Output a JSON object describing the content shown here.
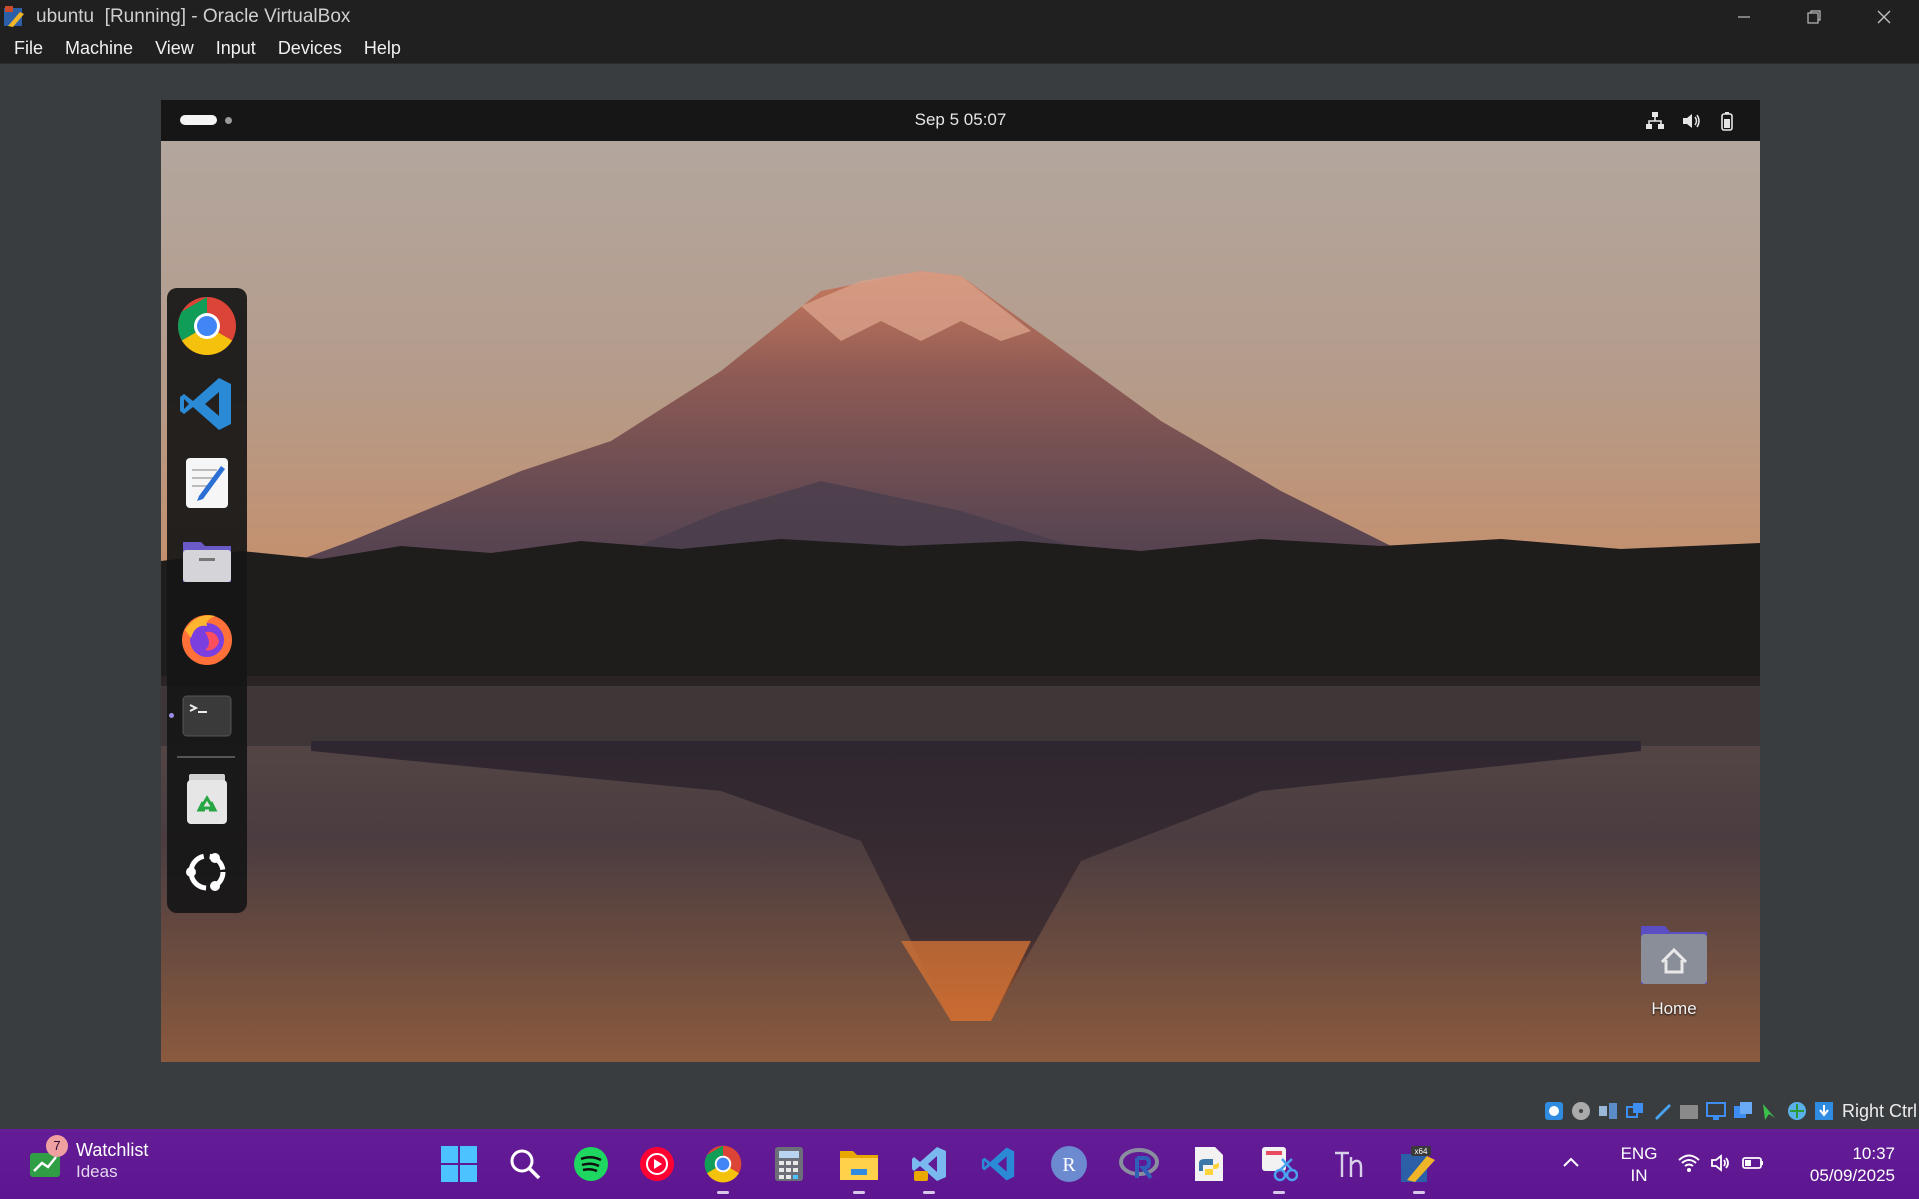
{
  "window": {
    "title": "ubuntu  [Running] - Oracle VirtualBox",
    "controls": [
      "minimize-icon",
      "restore-icon",
      "close-icon"
    ]
  },
  "menu": [
    "File",
    "Machine",
    "View",
    "Input",
    "Devices",
    "Help"
  ],
  "guest": {
    "topbar": {
      "clock": "Sep 5  05:07",
      "system_icons": [
        "network-icon",
        "volume-icon",
        "battery-icon"
      ]
    },
    "dock": [
      {
        "name": "Google Chrome",
        "icon": "chrome-icon"
      },
      {
        "name": "Visual Studio Code",
        "icon": "vscode-icon"
      },
      {
        "name": "Text Editor",
        "icon": "text-editor-icon"
      },
      {
        "name": "Files",
        "icon": "files-icon"
      },
      {
        "name": "Firefox",
        "icon": "firefox-icon"
      },
      {
        "name": "Terminal",
        "icon": "terminal-icon",
        "running": true
      },
      {
        "name": "Trash",
        "icon": "trash-icon"
      },
      {
        "name": "Show Apps",
        "icon": "ubuntu-apps-icon"
      }
    ],
    "desktop": {
      "home_label": "Home"
    }
  },
  "vbox_status": {
    "icons": [
      "hard-disk-icon",
      "optical-disk-icon",
      "audio-icon",
      "network-icon",
      "usb-icon",
      "shared-folders-icon",
      "display-icon",
      "video-capture-icon",
      "mouse-integration-icon",
      "keyboard-icon",
      "download-icon"
    ],
    "host_key": "Right Ctrl"
  },
  "taskbar": {
    "widget": {
      "badge": "7",
      "title": "Watchlist",
      "subtitle": "Ideas"
    },
    "apps": [
      {
        "icon": "windows-start-icon"
      },
      {
        "icon": "search-icon"
      },
      {
        "icon": "spotify-icon"
      },
      {
        "icon": "youtube-music-icon"
      },
      {
        "icon": "chrome-icon",
        "running": true
      },
      {
        "icon": "calculator-icon"
      },
      {
        "icon": "file-explorer-icon",
        "running": true
      },
      {
        "icon": "visual-studio-icon",
        "running": true
      },
      {
        "icon": "vscode-icon"
      },
      {
        "icon": "r-icon"
      },
      {
        "icon": "rstudio-icon"
      },
      {
        "icon": "python-idle-icon"
      },
      {
        "icon": "snipping-tool-icon",
        "running": true
      },
      {
        "icon": "typora-icon"
      },
      {
        "icon": "virtualbox-icon",
        "running": true
      }
    ],
    "language": {
      "line1": "ENG",
      "line2": "IN"
    },
    "clock": {
      "time": "10:37",
      "date": "05/09/2025"
    }
  },
  "colors": {
    "taskbar": "#5d1690",
    "host_background": "#3a3d40",
    "guest_topbar": "#161616"
  }
}
